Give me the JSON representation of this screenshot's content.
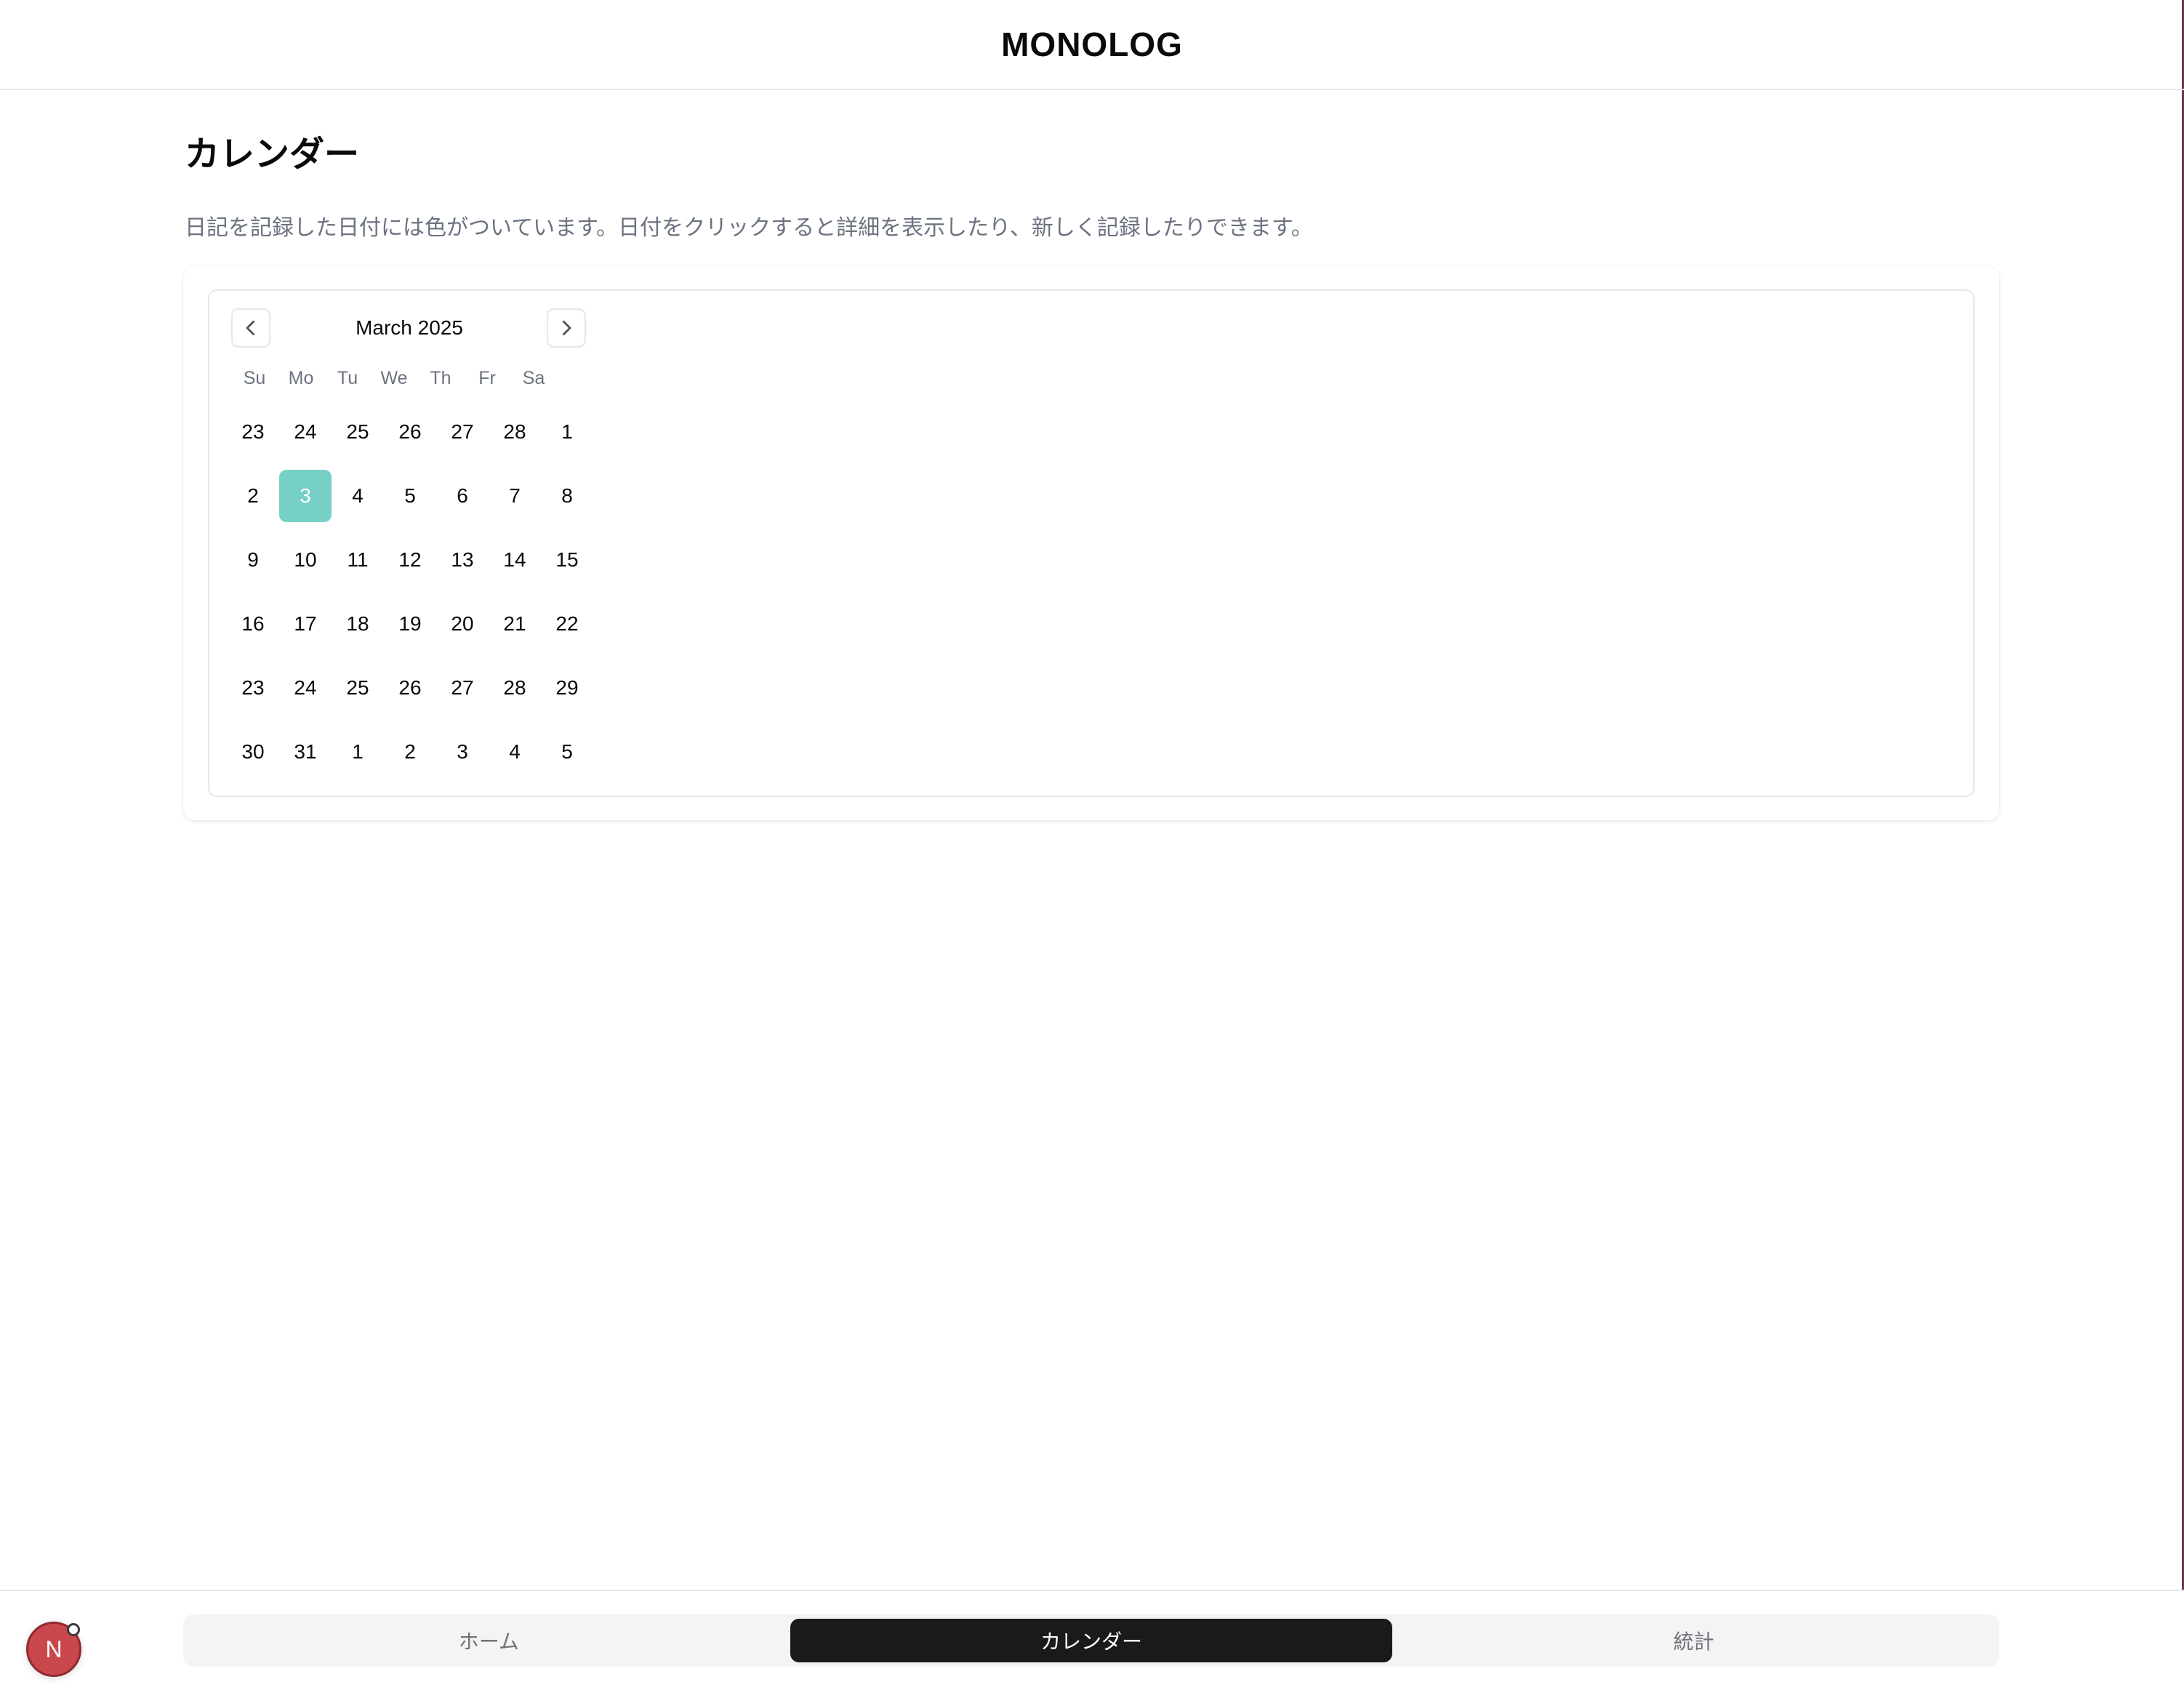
{
  "app": {
    "title": "MONOLOG"
  },
  "page": {
    "title": "カレンダー",
    "description": "日記を記録した日付には色がついています。日付をクリックすると詳細を表示したり、新しく記録したりできます。"
  },
  "calendar": {
    "month_label": "March 2025",
    "prev_icon": "chevron-left-icon",
    "next_icon": "chevron-right-icon",
    "weekdays": [
      "Su",
      "Mo",
      "Tu",
      "We",
      "Th",
      "Fr",
      "Sa"
    ],
    "selected_color": "#77d0c6",
    "weeks": [
      [
        {
          "d": "23"
        },
        {
          "d": "24"
        },
        {
          "d": "25"
        },
        {
          "d": "26"
        },
        {
          "d": "27"
        },
        {
          "d": "28"
        },
        {
          "d": "1"
        }
      ],
      [
        {
          "d": "2"
        },
        {
          "d": "3",
          "selected": true
        },
        {
          "d": "4"
        },
        {
          "d": "5"
        },
        {
          "d": "6"
        },
        {
          "d": "7"
        },
        {
          "d": "8"
        }
      ],
      [
        {
          "d": "9"
        },
        {
          "d": "10"
        },
        {
          "d": "11"
        },
        {
          "d": "12"
        },
        {
          "d": "13"
        },
        {
          "d": "14"
        },
        {
          "d": "15"
        }
      ],
      [
        {
          "d": "16"
        },
        {
          "d": "17"
        },
        {
          "d": "18"
        },
        {
          "d": "19"
        },
        {
          "d": "20"
        },
        {
          "d": "21"
        },
        {
          "d": "22"
        }
      ],
      [
        {
          "d": "23"
        },
        {
          "d": "24"
        },
        {
          "d": "25"
        },
        {
          "d": "26"
        },
        {
          "d": "27"
        },
        {
          "d": "28"
        },
        {
          "d": "29"
        }
      ],
      [
        {
          "d": "30"
        },
        {
          "d": "31"
        },
        {
          "d": "1"
        },
        {
          "d": "2"
        },
        {
          "d": "3"
        },
        {
          "d": "4"
        },
        {
          "d": "5"
        }
      ]
    ]
  },
  "tabs": [
    {
      "label": "ホーム",
      "active": false
    },
    {
      "label": "カレンダー",
      "active": true
    },
    {
      "label": "統計",
      "active": false
    }
  ],
  "avatar": {
    "initial": "N",
    "color": "#c8484d"
  }
}
